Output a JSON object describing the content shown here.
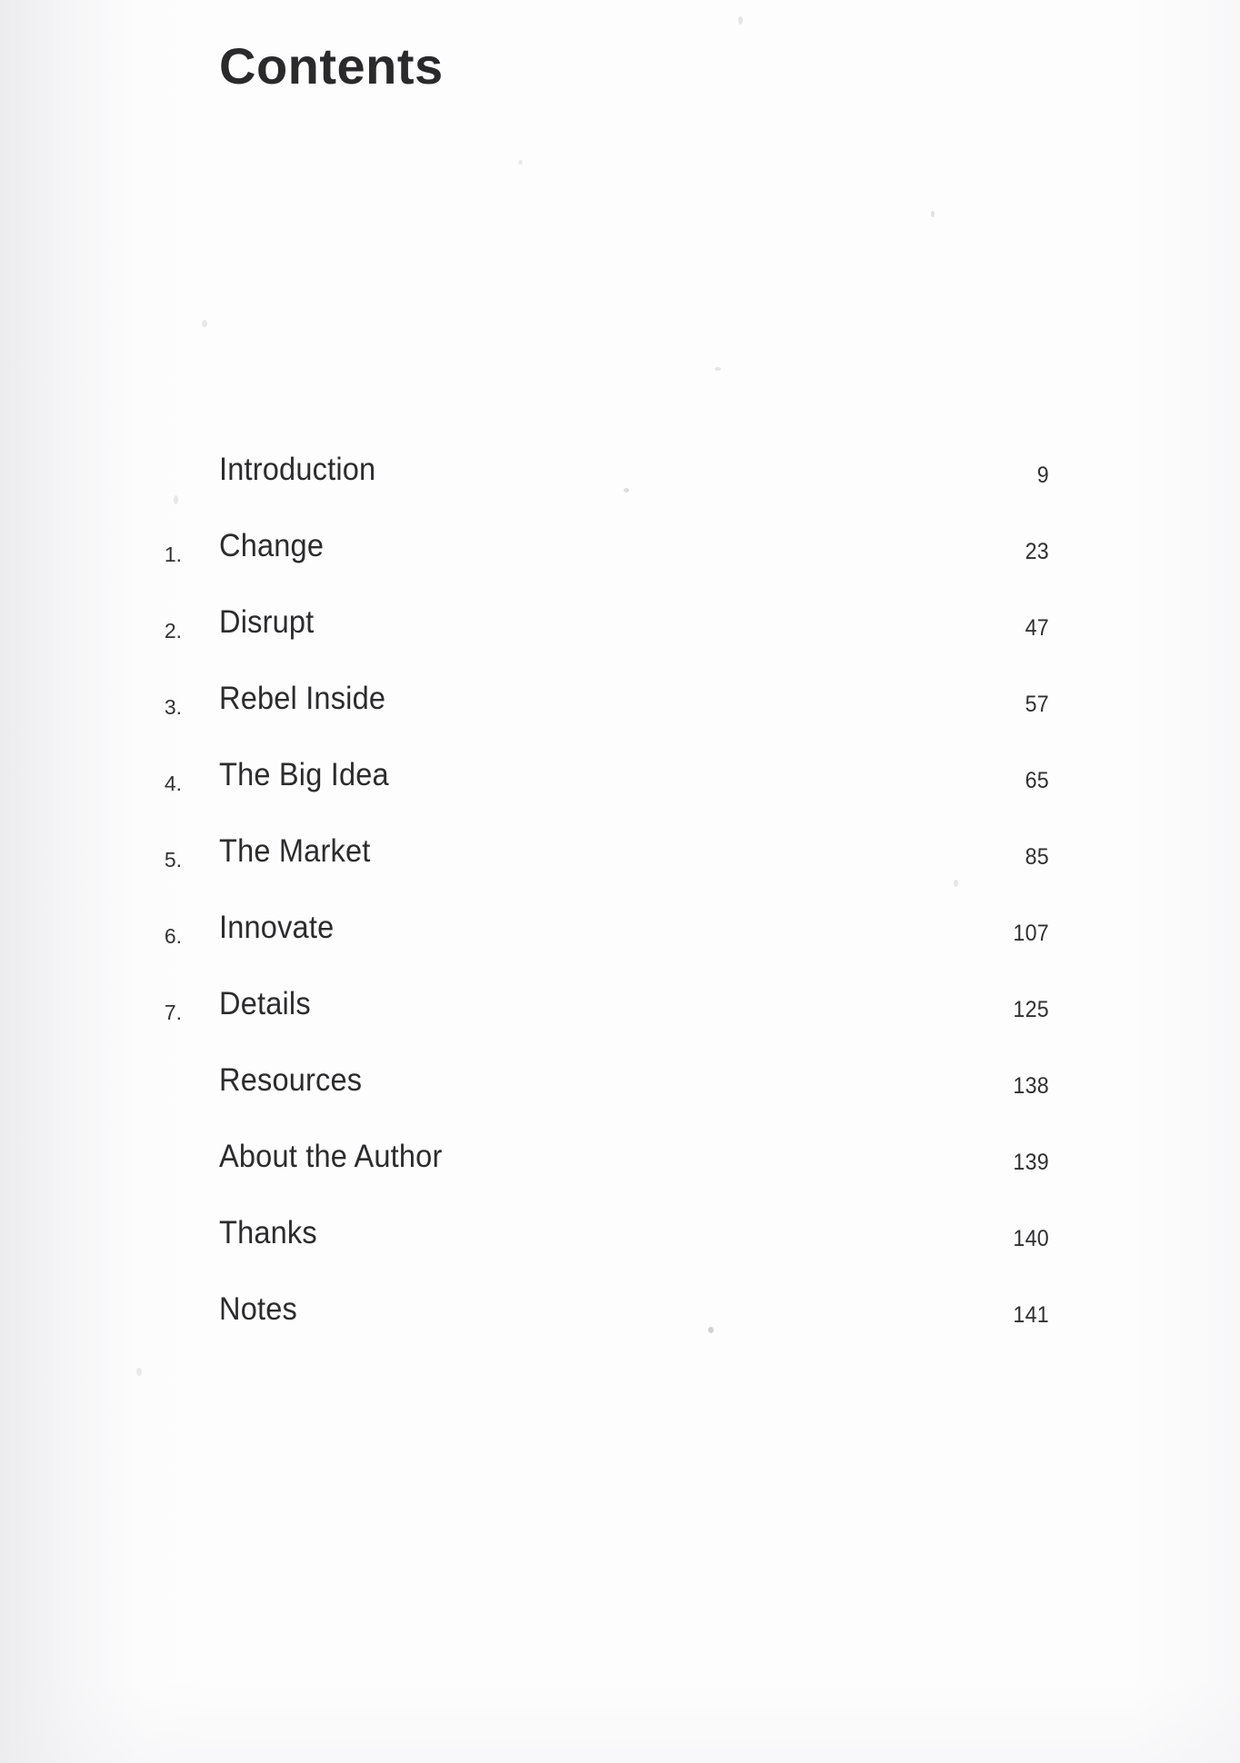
{
  "page": {
    "title": "Contents",
    "background_color": "#fdfdfd",
    "text_color": "#2c2c2e"
  },
  "toc": {
    "entries": [
      {
        "number": "",
        "title": "Introduction",
        "page": "9"
      },
      {
        "number": "1.",
        "title": "Change",
        "page": "23"
      },
      {
        "number": "2.",
        "title": "Disrupt",
        "page": "47"
      },
      {
        "number": "3.",
        "title": "Rebel Inside",
        "page": "57"
      },
      {
        "number": "4.",
        "title": "The Big Idea",
        "page": "65"
      },
      {
        "number": "5.",
        "title": "The Market",
        "page": "85"
      },
      {
        "number": "6.",
        "title": "Innovate",
        "page": "107"
      },
      {
        "number": "7.",
        "title": "Details",
        "page": "125"
      },
      {
        "number": "",
        "title": "Resources",
        "page": "138"
      },
      {
        "number": "",
        "title": "About the Author",
        "page": "139"
      },
      {
        "number": "",
        "title": "Thanks",
        "page": "140"
      },
      {
        "number": "",
        "title": "Notes",
        "page": "141"
      }
    ]
  }
}
